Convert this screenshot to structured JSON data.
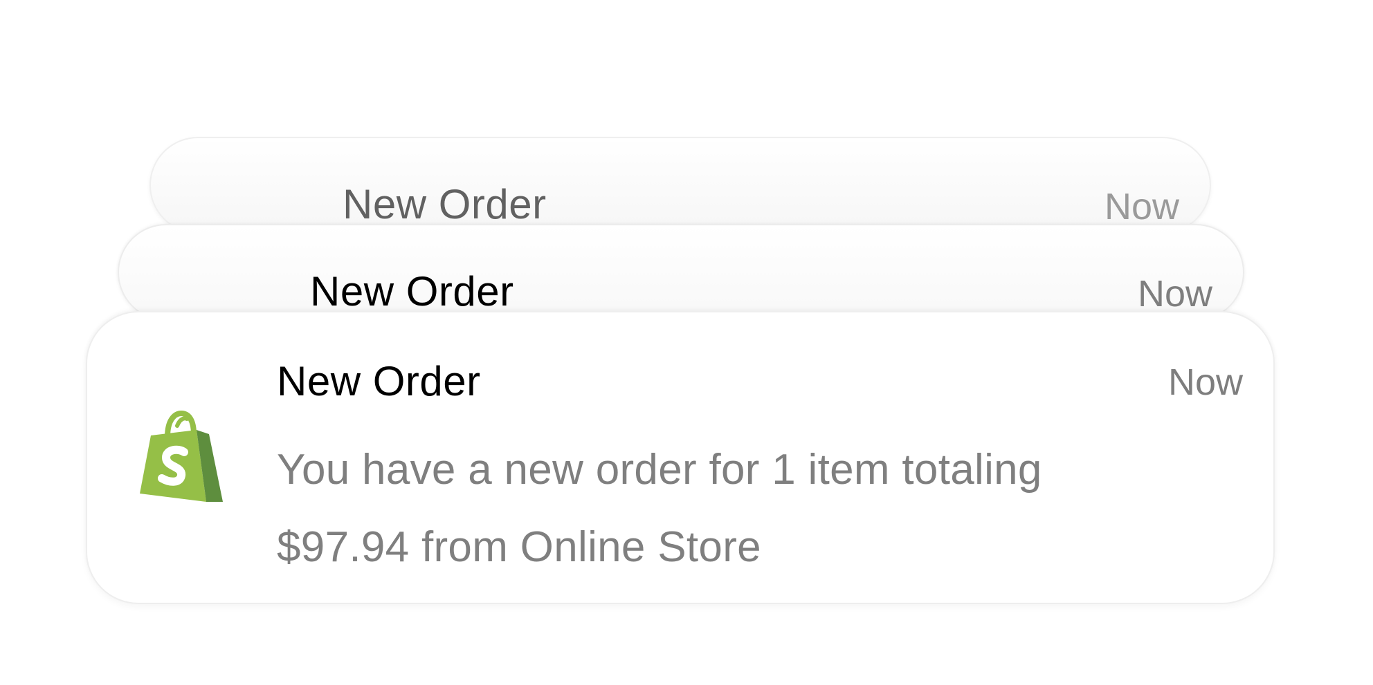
{
  "notifications": [
    {
      "title": "New Order",
      "time": "Now"
    },
    {
      "title": "New Order",
      "time": "Now"
    },
    {
      "title": "New Order",
      "time": "Now",
      "body_line_1": "You have a new order for 1 item totaling",
      "body_line_2": "$97.94 from Online Store",
      "app_icon": "shopify-bag-icon"
    }
  ],
  "colors": {
    "icon_green_light": "#95bf47",
    "icon_green_dark": "#5e8e3e",
    "body_text": "#7f7f7f",
    "title_text": "#000000"
  }
}
